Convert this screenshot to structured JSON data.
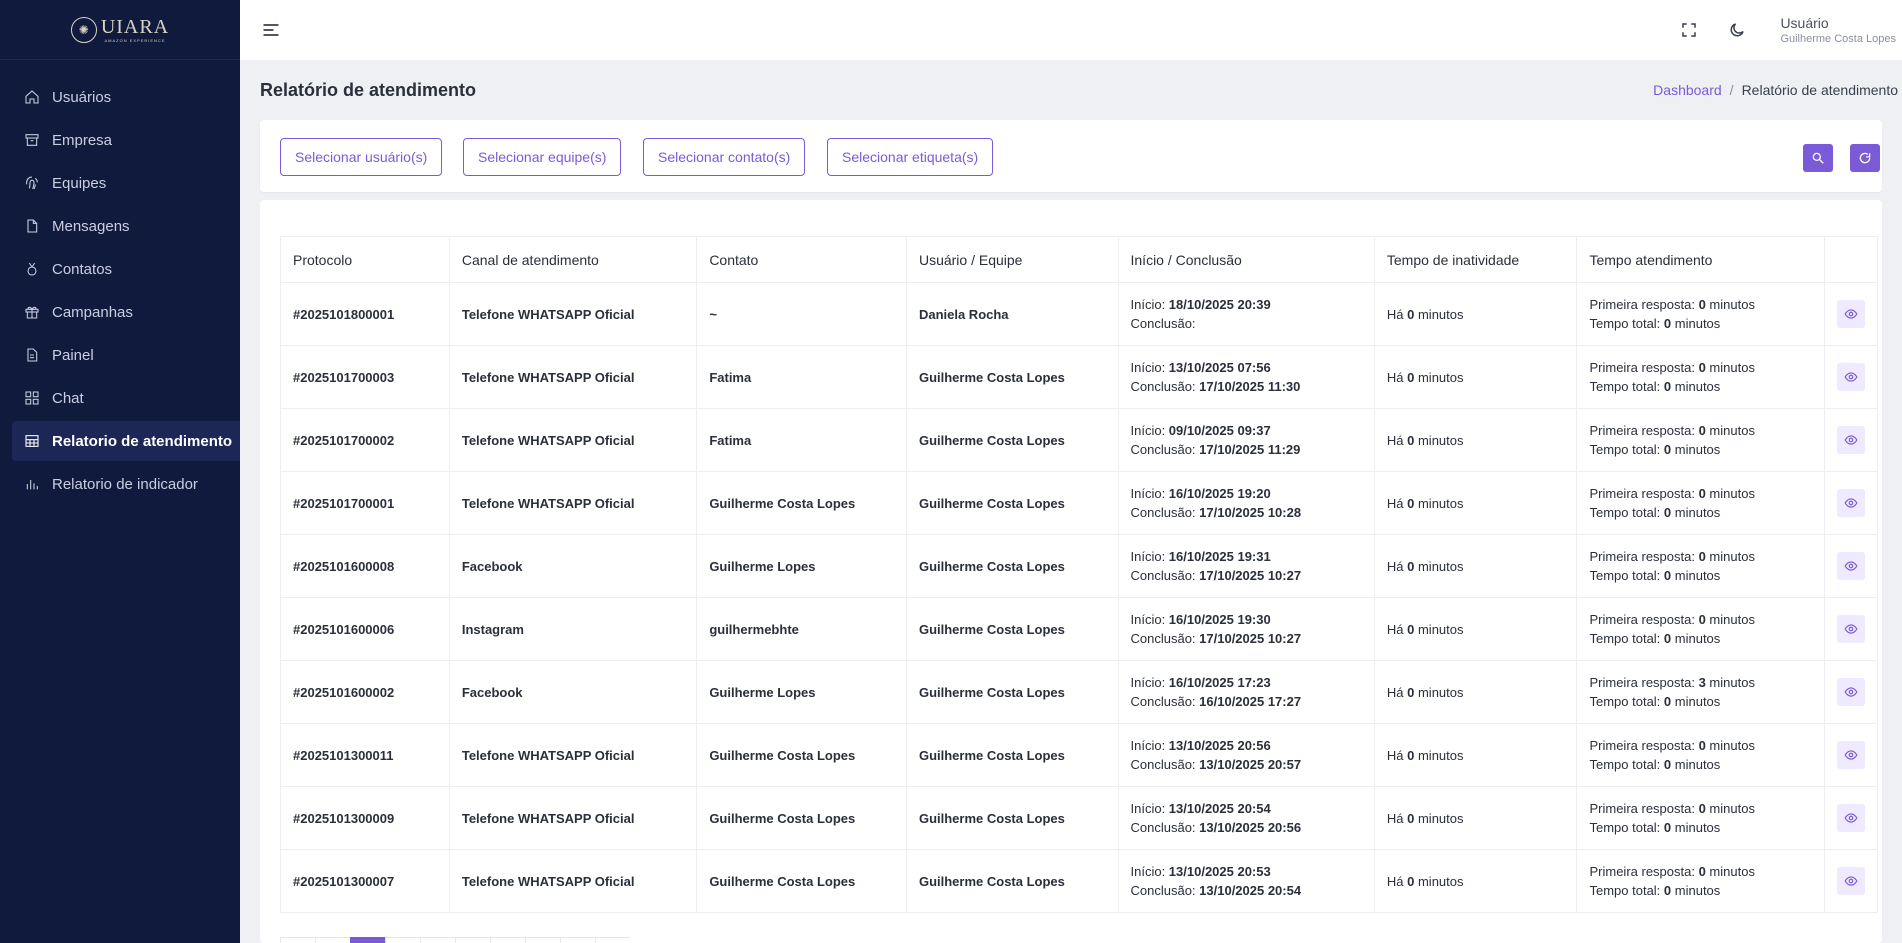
{
  "app": {
    "logo_text": "UIARA",
    "logo_subtext": "AMAZON EXPERIENCE"
  },
  "sidebar": {
    "items": [
      {
        "label": "Usuários",
        "icon": "home-icon"
      },
      {
        "label": "Empresa",
        "icon": "archive-icon"
      },
      {
        "label": "Equipes",
        "icon": "fingerprint-icon"
      },
      {
        "label": "Mensagens",
        "icon": "file-icon"
      },
      {
        "label": "Contatos",
        "icon": "medal-icon"
      },
      {
        "label": "Campanhas",
        "icon": "gift-icon"
      },
      {
        "label": "Painel",
        "icon": "file-text-icon"
      },
      {
        "label": "Chat",
        "icon": "grid-icon"
      },
      {
        "label": "Relatorio de atendimento",
        "icon": "table-icon",
        "active": true
      },
      {
        "label": "Relatorio de indicador",
        "icon": "bar-chart-icon"
      }
    ]
  },
  "header": {
    "user_title": "Usuário",
    "user_name": "Guilherme Costa Lopes"
  },
  "page": {
    "title": "Relatório de atendimento",
    "breadcrumb": {
      "home": "Dashboard",
      "separator": "/",
      "current": "Relatório de atendimento"
    }
  },
  "filters": {
    "users": "Selecionar usuário(s)",
    "teams": "Selecionar equipe(s)",
    "contacts": "Selecionar contato(s)",
    "tags": "Selecionar etiqueta(s)"
  },
  "table": {
    "headers": {
      "protocolo": "Protocolo",
      "canal": "Canal de atendimento",
      "contato": "Contato",
      "usuario": "Usuário / Equipe",
      "inicio": "Início / Conclusão",
      "inatividade": "Tempo de inatividade",
      "tempo": "Tempo atendimento"
    },
    "labels": {
      "inicio": "Início: ",
      "conclusao": "Conclusão: ",
      "ha": "Há ",
      "minutos": " minutos",
      "primeira": "Primeira resposta: ",
      "total": "Tempo total: "
    },
    "rows": [
      {
        "protocolo": "#2025101800001",
        "canal": "Telefone WHATSAPP Oficial",
        "contato": "~",
        "usuario": "Daniela Rocha",
        "inicio": "18/10/2025 20:39",
        "conclusao": "",
        "inatividade": "0",
        "primeira": "0",
        "total": "0"
      },
      {
        "protocolo": "#2025101700003",
        "canal": "Telefone WHATSAPP Oficial",
        "contato": "Fatima",
        "usuario": "Guilherme Costa Lopes",
        "inicio": "13/10/2025 07:56",
        "conclusao": "17/10/2025 11:30",
        "inatividade": "0",
        "primeira": "0",
        "total": "0"
      },
      {
        "protocolo": "#2025101700002",
        "canal": "Telefone WHATSAPP Oficial",
        "contato": "Fatima",
        "usuario": "Guilherme Costa Lopes",
        "inicio": "09/10/2025 09:37",
        "conclusao": "17/10/2025 11:29",
        "inatividade": "0",
        "primeira": "0",
        "total": "0"
      },
      {
        "protocolo": "#2025101700001",
        "canal": "Telefone WHATSAPP Oficial",
        "contato": "Guilherme Costa Lopes",
        "usuario": "Guilherme Costa Lopes",
        "inicio": "16/10/2025 19:20",
        "conclusao": "17/10/2025 10:28",
        "inatividade": "0",
        "primeira": "0",
        "total": "0"
      },
      {
        "protocolo": "#2025101600008",
        "canal": "Facebook",
        "contato": "Guilherme Lopes",
        "usuario": "Guilherme Costa Lopes",
        "inicio": "16/10/2025 19:31",
        "conclusao": "17/10/2025 10:27",
        "inatividade": "0",
        "primeira": "0",
        "total": "0"
      },
      {
        "protocolo": "#2025101600006",
        "canal": "Instagram",
        "contato": "guilhermebhte",
        "usuario": "Guilherme Costa Lopes",
        "inicio": "16/10/2025 19:30",
        "conclusao": "17/10/2025 10:27",
        "inatividade": "0",
        "primeira": "0",
        "total": "0"
      },
      {
        "protocolo": "#2025101600002",
        "canal": "Facebook",
        "contato": "Guilherme Lopes",
        "usuario": "Guilherme Costa Lopes",
        "inicio": "16/10/2025 17:23",
        "conclusao": "16/10/2025 17:27",
        "inatividade": "0",
        "primeira": "3",
        "total": "0"
      },
      {
        "protocolo": "#2025101300011",
        "canal": "Telefone WHATSAPP Oficial",
        "contato": "Guilherme Costa Lopes",
        "usuario": "Guilherme Costa Lopes",
        "inicio": "13/10/2025 20:56",
        "conclusao": "13/10/2025 20:57",
        "inatividade": "0",
        "primeira": "0",
        "total": "0"
      },
      {
        "protocolo": "#2025101300009",
        "canal": "Telefone WHATSAPP Oficial",
        "contato": "Guilherme Costa Lopes",
        "usuario": "Guilherme Costa Lopes",
        "inicio": "13/10/2025 20:54",
        "conclusao": "13/10/2025 20:56",
        "inatividade": "0",
        "primeira": "0",
        "total": "0"
      },
      {
        "protocolo": "#2025101300007",
        "canal": "Telefone WHATSAPP Oficial",
        "contato": "Guilherme Costa Lopes",
        "usuario": "Guilherme Costa Lopes",
        "inicio": "13/10/2025 20:53",
        "conclusao": "13/10/2025 20:54",
        "inatividade": "0",
        "primeira": "0",
        "total": "0"
      }
    ]
  },
  "pagination": {
    "active_page_index": 2
  },
  "colors": {
    "accent": "#7b5ad8",
    "sidebar_bg": "#101a3d",
    "page_bg": "#eef0f4"
  }
}
